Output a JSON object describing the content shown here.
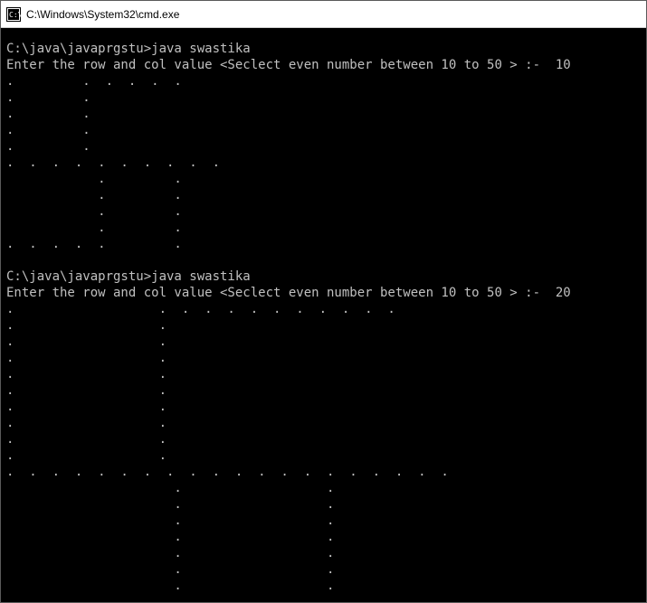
{
  "titlebar": {
    "title": "C:\\Windows\\System32\\cmd.exe"
  },
  "console": {
    "lines": [
      "C:\\java\\javaprgstu>java swastika",
      "Enter the row and col value <Seclect even number between 10 to 50 > :-  10",
      ".         .  .  .  .  .",
      ".         .",
      ".         .",
      ".         .",
      ".         .",
      ".  .  .  .  .  .  .  .  .  .",
      "            .         .",
      "            .         .",
      "            .         .",
      "            .         .",
      ".  .  .  .  .         .",
      "",
      "C:\\java\\javaprgstu>java swastika",
      "Enter the row and col value <Seclect even number between 10 to 50 > :-  20",
      ".                   .  .  .  .  .  .  .  .  .  .  .",
      ".                   .",
      ".                   .",
      ".                   .",
      ".                   .",
      ".                   .",
      ".                   .",
      ".                   .",
      ".                   .",
      ".                   .",
      ".  .  .  .  .  .  .  .  .  .  .  .  .  .  .  .  .  .  .  .",
      "                      .                   .",
      "                      .                   .",
      "                      .                   .",
      "                      .                   .",
      "                      .                   .",
      "                      .                   .",
      "                      .                   .",
      "                      .                   ."
    ]
  }
}
